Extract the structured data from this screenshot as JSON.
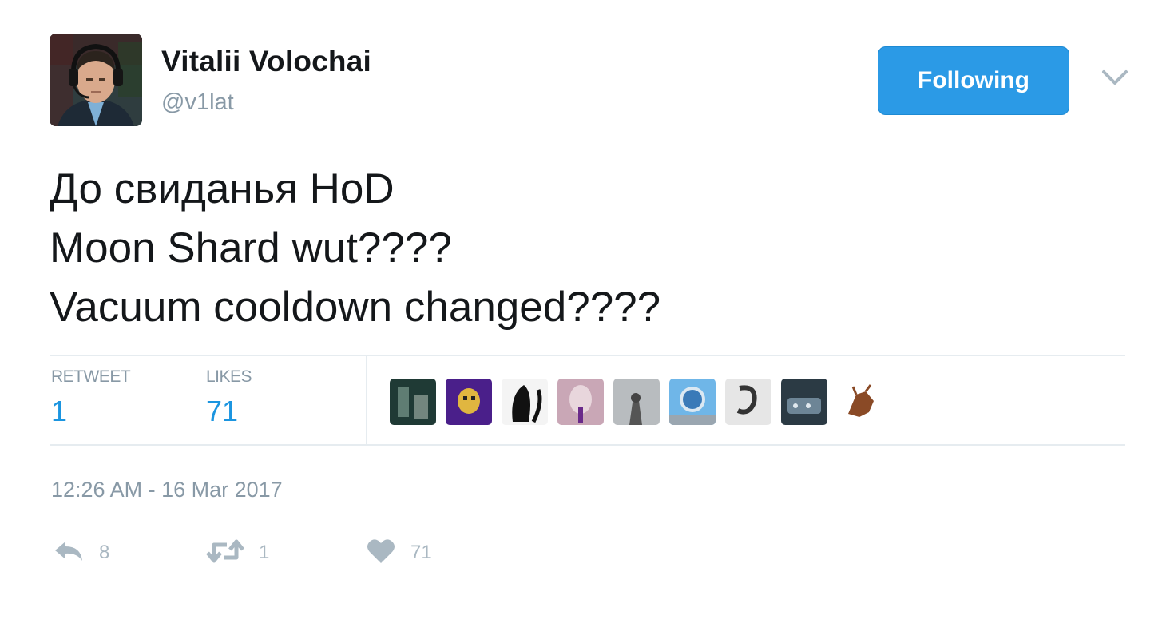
{
  "author": {
    "display_name": "Vitalii Volochai",
    "screen_name": "@v1lat"
  },
  "follow_button": {
    "label": "Following"
  },
  "tweet": {
    "lines": [
      "До свиданья HoD",
      "Moon Shard wut????",
      "Vacuum cooldown changed????"
    ]
  },
  "stats": {
    "retweets_label": "RETWEET",
    "retweets_value": "1",
    "likes_label": "LIKES",
    "likes_value": "71"
  },
  "timestamp": "12:26 AM - 16 Mar 2017",
  "actions": {
    "reply_count": "8",
    "retweet_count": "1",
    "like_count": "71"
  },
  "colors": {
    "accent": "#1b95e0",
    "follow_button": "#2b9ae6",
    "muted": "#8899a6"
  }
}
